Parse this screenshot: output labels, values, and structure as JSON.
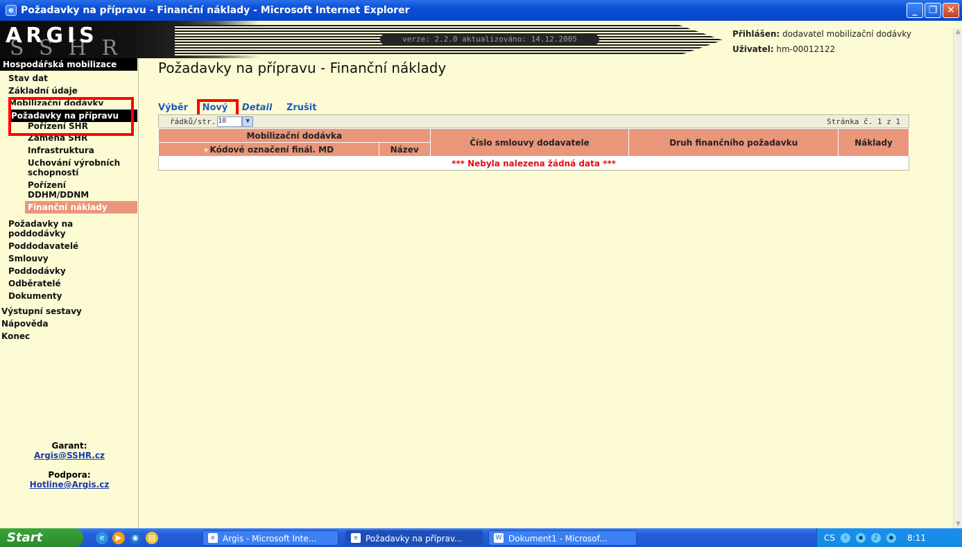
{
  "window": {
    "title": "Požadavky na přípravu - Finanční náklady - Microsoft Internet Explorer",
    "icon": "ie-icon",
    "controls": [
      "_",
      "❐",
      "✕"
    ]
  },
  "header": {
    "logo": "ARGIS",
    "logo_shadow": "SSHR",
    "version": "verze: 2.2.0 aktualizováno: 14.12.2005",
    "logged_label": "Přihlášen:",
    "logged_value": "dodavatel mobilizační dodávky",
    "user_label": "Uživatel:",
    "user_value": "hm-00012122"
  },
  "sidebar": {
    "head": "Hospodářská mobilizace",
    "items": [
      {
        "label": "Stav dat"
      },
      {
        "label": "Základní údaje"
      },
      {
        "label": "Mobilizační dodávky"
      },
      {
        "label": "Požadavky na přípravu"
      },
      {
        "label": "Pořízení SHR"
      },
      {
        "label": "Záměna SHR"
      },
      {
        "label": "Infrastruktura"
      },
      {
        "label": "Uchování výrobních schopností"
      },
      {
        "label": "Pořízení DDHM/DDNM"
      },
      {
        "label": "Finanční náklady"
      },
      {
        "label": "Požadavky na poddodávky"
      },
      {
        "label": "Poddodavatelé"
      },
      {
        "label": "Smlouvy"
      },
      {
        "label": "Poddodávky"
      },
      {
        "label": "Odběratelé"
      },
      {
        "label": "Dokumenty"
      },
      {
        "label": "Výstupní sestavy"
      },
      {
        "label": "Nápověda"
      },
      {
        "label": "Konec"
      }
    ],
    "garant_label": "Garant:",
    "garant_email": "Argis@SSHR.cz",
    "support_label": "Podpora:",
    "support_email": "Hotline@Argis.cz"
  },
  "main": {
    "title": "Požadavky na přípravu - Finanční náklady",
    "toolbar": {
      "select": "Výběr",
      "new": "Nový",
      "detail": "Detail",
      "cancel": "Zrušit"
    },
    "grid": {
      "rows_label": "řádků/str.",
      "rows_value": "10",
      "pager": "Stránka č. 1 z 1",
      "group_header": "Mobilizační dodávka",
      "col_code": "Kódové označení finál. MD",
      "col_name": "Název",
      "col_contract": "Číslo smlouvy dodavatele",
      "col_type": "Druh finančního požadavku",
      "col_cost": "Náklady",
      "empty": "*** Nebyla nalezena žádná data ***"
    }
  },
  "taskbar": {
    "start": "Start",
    "tasks": [
      "Argis - Microsoft Inte...",
      "Požadavky na příprav...",
      "Dokument1 - Microsof..."
    ],
    "lang": "CS",
    "clock": "8:11"
  },
  "colors": {
    "accent": "#e9967a",
    "background": "#fdfbd4",
    "highlight": "#ff0000",
    "link": "#1d5cc0"
  }
}
